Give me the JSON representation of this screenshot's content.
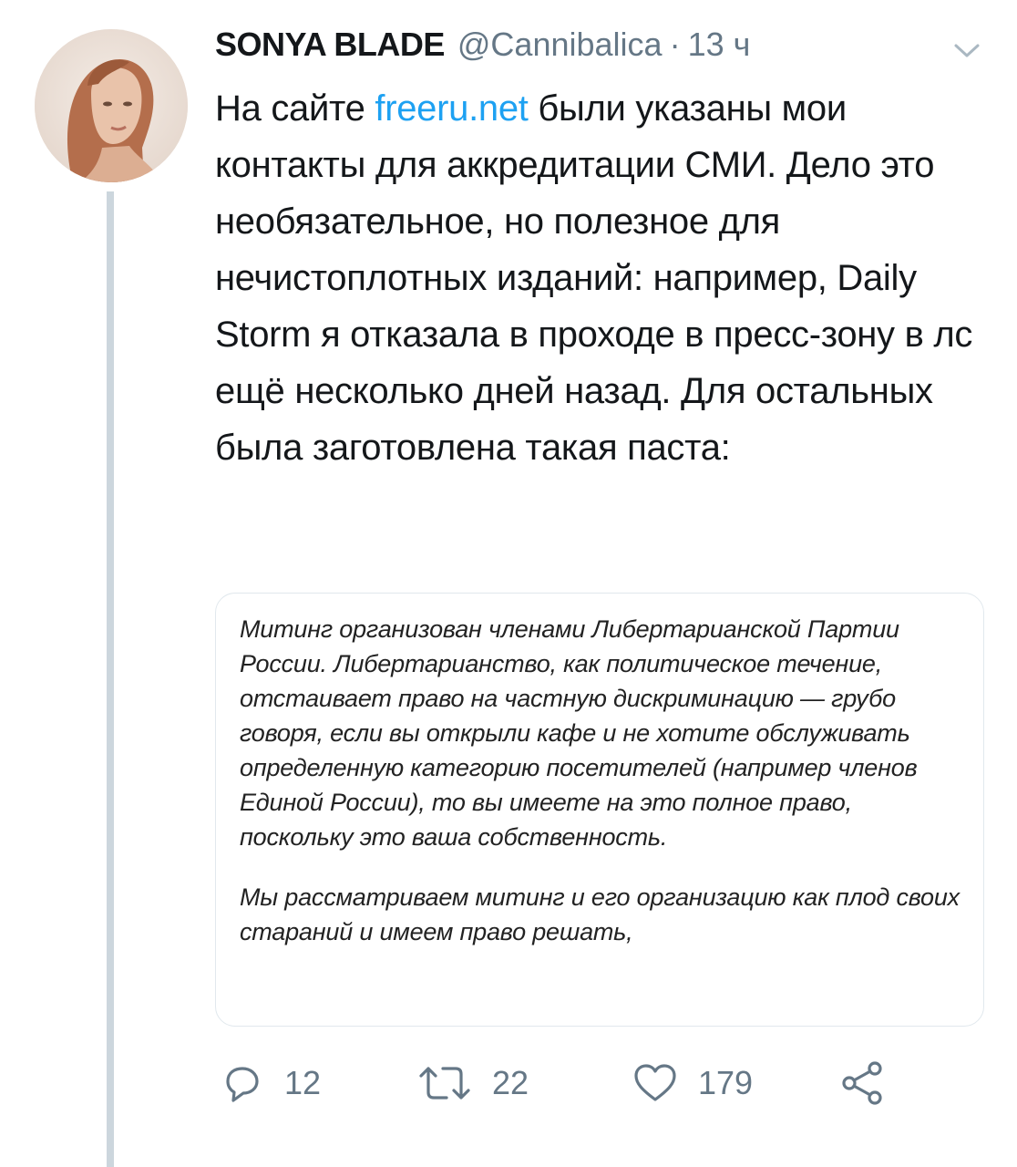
{
  "tweet": {
    "author_name": "SONYA BLADE",
    "handle": "@Cannibalica",
    "separator": "·",
    "time": "13 ч",
    "text_before_link": "На сайте ",
    "link_text": "freeru.net",
    "text_after_link": " были указаны мои контакты для аккредитации СМИ. Дело это необязательное, но полезное для нечистоплотных изданий: например, Daily Storm я отказала в проходе в пресс-зону в лс ещё несколько дней назад. Для остальных была заготовлена такая паста:",
    "image_text": {
      "paragraph_1": "Митинг организован членами Либертарианской Партии России. Либертарианство, как политическое течение, отстаивает право на частную дискриминацию — грубо говоря, если вы открыли кафе и не хотите обслуживать определенную категорию посетителей (например членов Единой России), то вы имеете на это полное право, поскольку это ваша собственность.",
      "paragraph_2": "Мы рассматриваем митинг и его организацию как плод своих стараний и имеем право решать,"
    },
    "actions": {
      "reply_count": "12",
      "retweet_count": "22",
      "like_count": "179"
    },
    "icons": [
      "chevron-down-icon",
      "reply-icon",
      "retweet-icon",
      "like-icon",
      "share-icon"
    ],
    "colors": {
      "link": "#1da1f2",
      "muted": "#657786",
      "thread_line": "#ccd6dd"
    }
  }
}
